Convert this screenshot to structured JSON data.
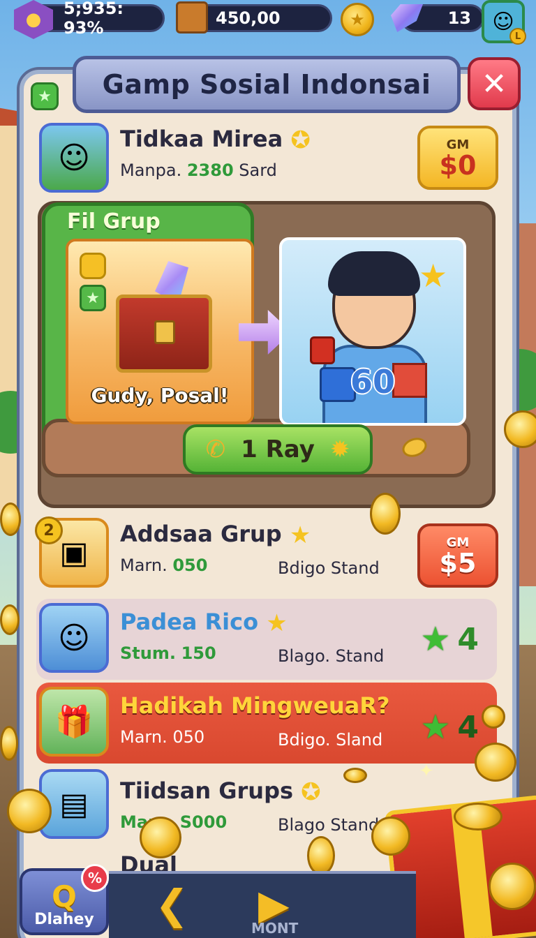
{
  "top_bar": {
    "level_value": "5;935: 93%",
    "chests_value": "450,00",
    "gems_value": "13",
    "avatar_badge": "L"
  },
  "dialog": {
    "title": "Gamp Sosial Indonsai",
    "close_label": "✕"
  },
  "top_row": {
    "name": "Tidkaa Mirea",
    "sub_prefix": "Manpa.",
    "sub_number": "2380",
    "sub_suffix": "Sard",
    "price_label": "GM",
    "price_value": "$0"
  },
  "featured": {
    "title": "Fil Grup",
    "left_caption": "Gudy, Posal!",
    "right_number": "60",
    "action_label": "1 Ray"
  },
  "rows": [
    {
      "name": "Addsaa Grup",
      "sub_prefix": "Marn.",
      "sub_number": "050",
      "right_text": "Bdigo Stand",
      "price_label": "GM",
      "price_value": "$5",
      "thumb_badge": "2"
    },
    {
      "name": "Padea Rico",
      "sub_prefix": "Stum.",
      "sub_number": "150",
      "right_text": "Blago. Stand",
      "star_count": "4"
    },
    {
      "name": "Hadikah MingweuaR?",
      "sub_prefix": "Marn.",
      "sub_number": "050",
      "right_text": "Bdigo. Sland",
      "star_count": "4"
    },
    {
      "name": "Tiidsan Grups",
      "sub_prefix": "Marn.",
      "sub_number": "S000",
      "right_text": "Blago Stand"
    }
  ],
  "partial_row": {
    "name": "Dual"
  },
  "bottom_bar": {
    "daily_label": "Dlahey",
    "daily_icon": "Q",
    "daily_badge": "%",
    "nav_label": "MONT"
  },
  "colors": {
    "panel_bg": "#f3e7d6",
    "title_banner": "#8995c6",
    "close_button": "#e13a4c",
    "highlight_row": "#d9482f",
    "price_yellow": "#f4b624",
    "price_red": "#ec5232",
    "accent_green": "#55b336"
  },
  "icons": {
    "level": "hex-badge-icon",
    "chests": "chest-icon",
    "coin": "coin-icon",
    "gem": "gem-icon",
    "star": "star-icon",
    "phone": "phone-icon",
    "gear": "gear-icon"
  }
}
